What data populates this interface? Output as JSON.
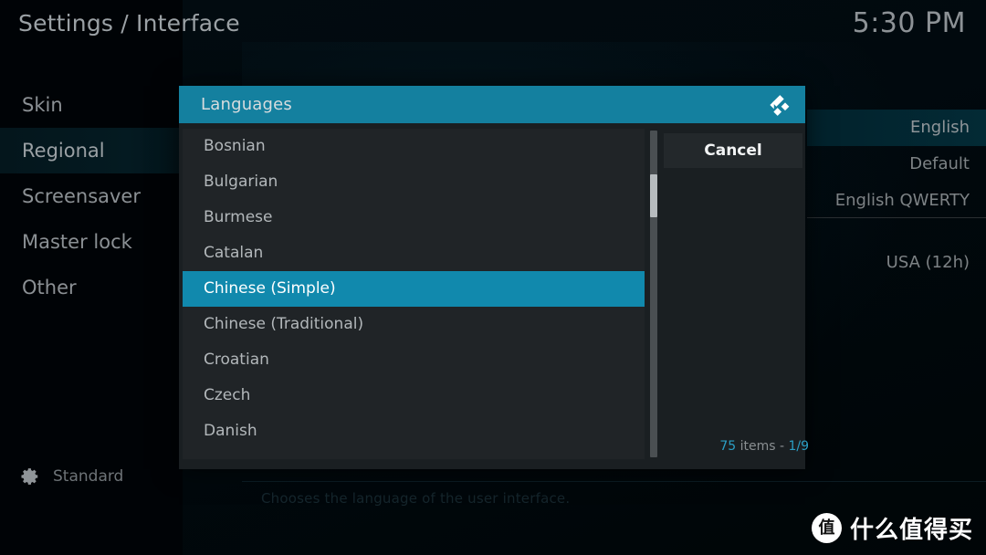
{
  "header": {
    "title": "Settings / Interface",
    "clock": "5:30 PM"
  },
  "sidebar": {
    "items": [
      {
        "label": "Skin",
        "selected": false
      },
      {
        "label": "Regional",
        "selected": true
      },
      {
        "label": "Screensaver",
        "selected": false
      },
      {
        "label": "Master lock",
        "selected": false
      },
      {
        "label": "Other",
        "selected": false
      }
    ],
    "footer": {
      "icon": "gear-icon",
      "label": "Standard"
    }
  },
  "settings_values": {
    "rows": [
      {
        "value": "English",
        "selected": true
      },
      {
        "value": "Default",
        "selected": false
      },
      {
        "value": "English QWERTY",
        "selected": false
      }
    ],
    "late_row": "USA (12h)"
  },
  "description": "Chooses the language of the user interface.",
  "dialog": {
    "title": "Languages",
    "logo_icon": "kodi-logo-icon",
    "cancel_label": "Cancel",
    "items": [
      {
        "label": "Bosnian",
        "selected": false
      },
      {
        "label": "Bulgarian",
        "selected": false
      },
      {
        "label": "Burmese",
        "selected": false
      },
      {
        "label": "Catalan",
        "selected": false
      },
      {
        "label": "Chinese (Simple)",
        "selected": true
      },
      {
        "label": "Chinese (Traditional)",
        "selected": false
      },
      {
        "label": "Croatian",
        "selected": false
      },
      {
        "label": "Czech",
        "selected": false
      },
      {
        "label": "Danish",
        "selected": false
      }
    ],
    "counter": {
      "total": "75",
      "middle": " items - ",
      "page": "1/9"
    }
  },
  "watermark": {
    "badge": "值",
    "text": "什么值得买"
  },
  "colors": {
    "accent": "#1189ad",
    "titlebar": "#14809f",
    "dialog_bg": "#1a1f22",
    "list_bg": "#202427",
    "counter_num": "#2b9ec4"
  }
}
